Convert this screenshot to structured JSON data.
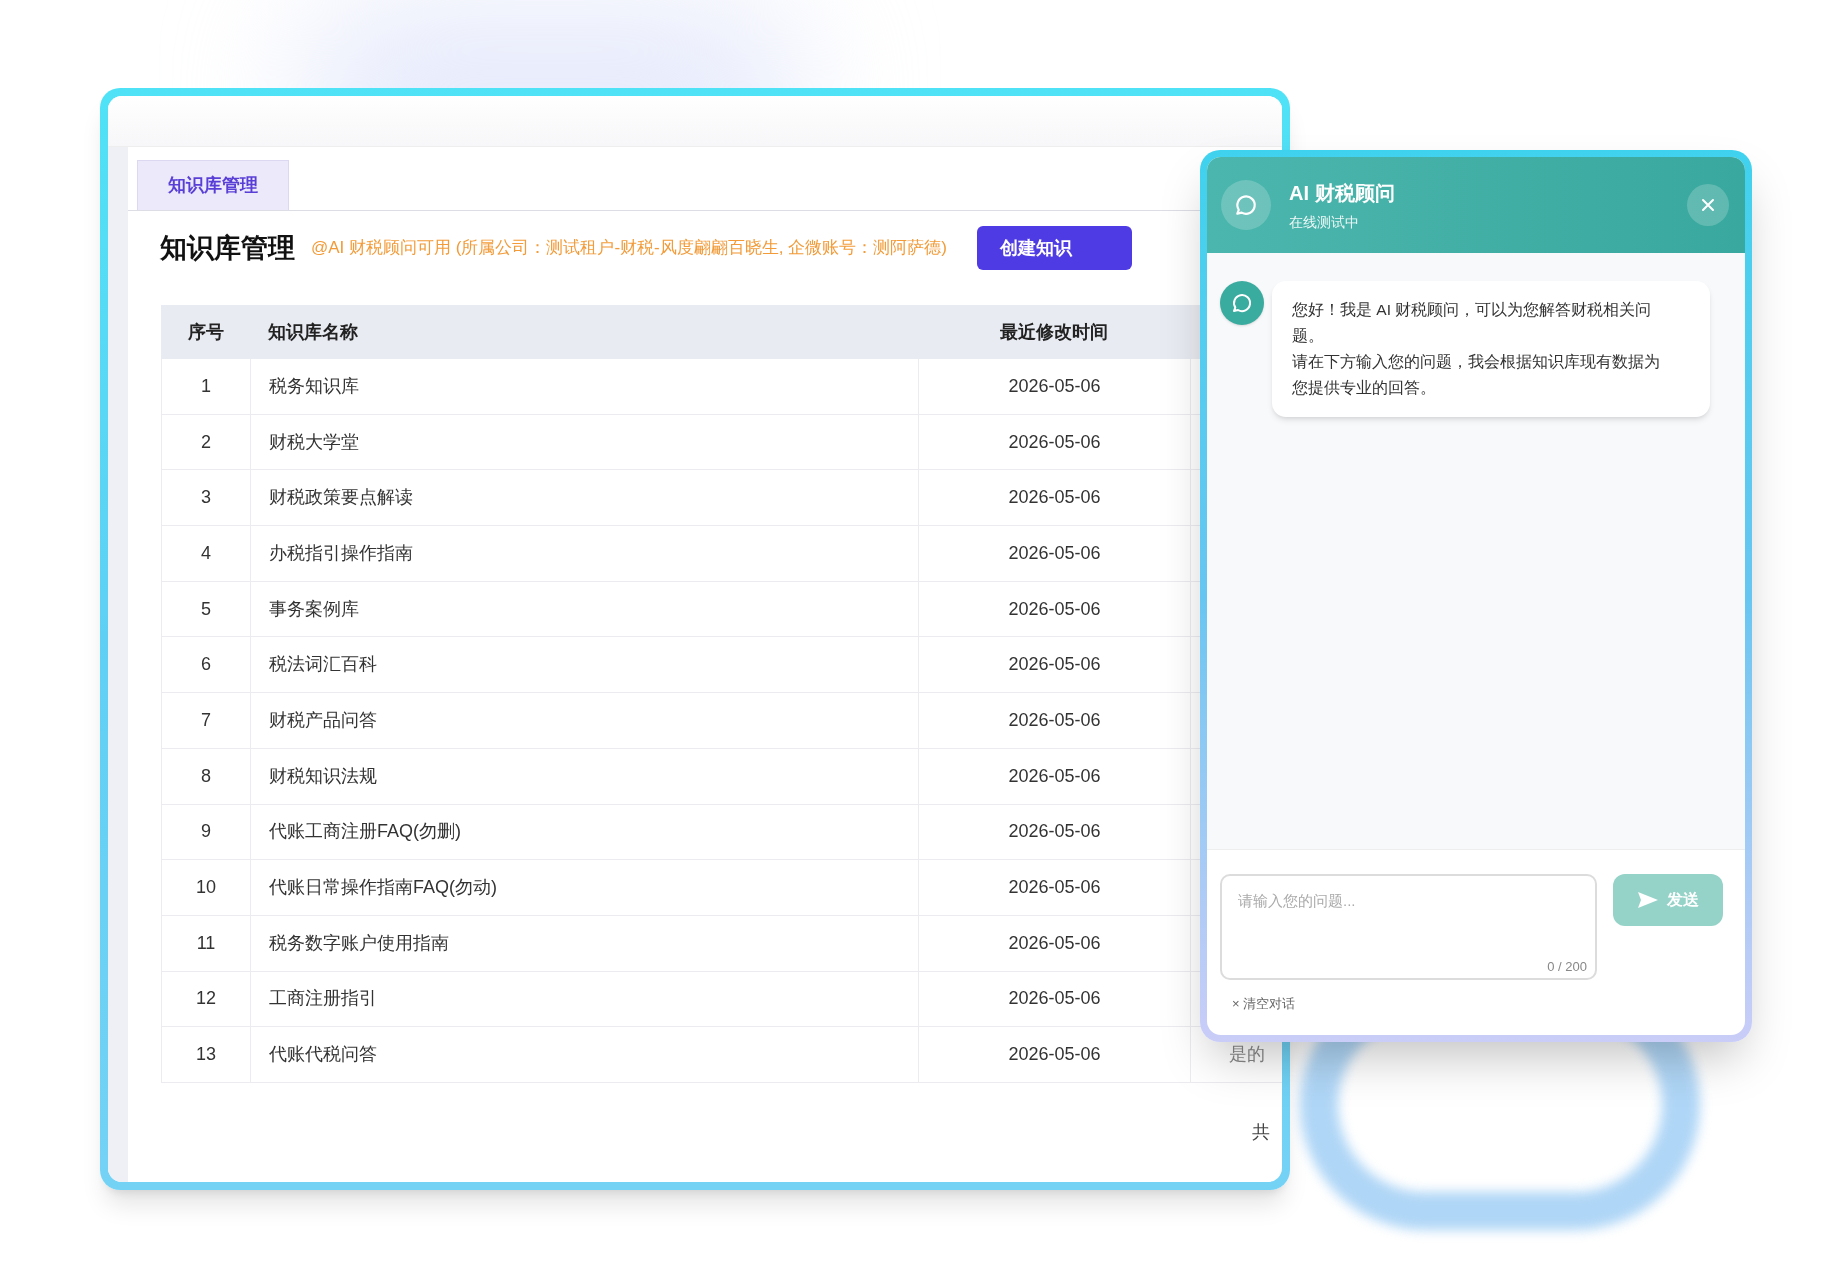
{
  "main_window": {
    "tabs": [
      {
        "label": "知识库管理",
        "selected": true
      }
    ],
    "page_title": "知识库管理",
    "notice": "@AI 财税顾问可用 (所属公司：测试租户-财税-风度翩翩百晓生, 企微账号：测阿萨德)",
    "create_button": "创建知识",
    "table": {
      "columns": [
        "序号",
        "知识库名称",
        "最近修改时间"
      ],
      "rows": [
        {
          "index": "1",
          "name": "税务知识库",
          "modified": "2026-05-06"
        },
        {
          "index": "2",
          "name": "财税大学堂",
          "modified": "2026-05-06"
        },
        {
          "index": "3",
          "name": "财税政策要点解读",
          "modified": "2026-05-06"
        },
        {
          "index": "4",
          "name": "办税指引操作指南",
          "modified": "2026-05-06"
        },
        {
          "index": "5",
          "name": "事务案例库",
          "modified": "2026-05-06"
        },
        {
          "index": "6",
          "name": "税法词汇百科",
          "modified": "2026-05-06"
        },
        {
          "index": "7",
          "name": "财税产品问答",
          "modified": "2026-05-06"
        },
        {
          "index": "8",
          "name": "财税知识法规",
          "modified": "2026-05-06"
        },
        {
          "index": "9",
          "name": "代账工商注册FAQ(勿删)",
          "modified": "2026-05-06"
        },
        {
          "index": "10",
          "name": "代账日常操作指南FAQ(勿动)",
          "modified": "2026-05-06"
        },
        {
          "index": "11",
          "name": "税务数字账户使用指南",
          "modified": "2026-05-06"
        },
        {
          "index": "12",
          "name": "工商注册指引",
          "modified": "2026-05-06"
        },
        {
          "index": "13",
          "name": "代账代税问答",
          "modified": "2026-05-06",
          "column_4": "是的"
        }
      ]
    },
    "pagination_total": "共"
  },
  "chat_panel": {
    "title": "AI 财税顾问",
    "subtitle": "在线测试中",
    "messages": [
      {
        "kind": "assistant",
        "lines": [
          "您好！我是 AI 财税顾问，可以为您解答财税相关问题。",
          "请在下方输入您的问题，我会根据知识库现有数据为您提供专业的回答。"
        ]
      }
    ],
    "input": {
      "placeholder": "请输入您的问题...",
      "counter": "0 / 200"
    },
    "send_button": {
      "label": "发送",
      "disabled": true
    },
    "clear_button": "× 清空对话"
  }
}
